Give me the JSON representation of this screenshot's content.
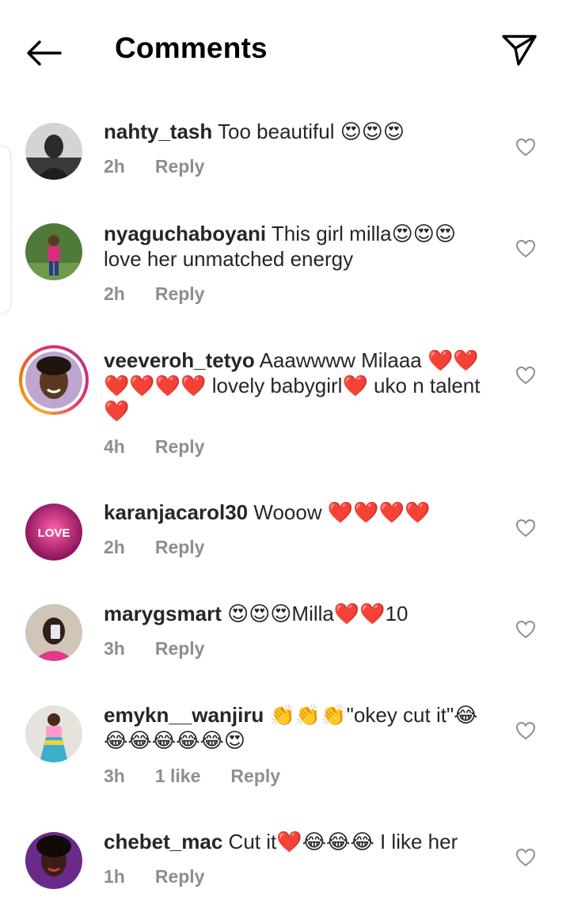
{
  "header": {
    "title": "Comments",
    "back_icon": "arrow-left-icon",
    "share_icon": "paper-plane-icon"
  },
  "comments": [
    {
      "username": "nahty_tash",
      "text": "Too beautiful 😍😍😍",
      "time": "2h",
      "likes": "",
      "reply": "Reply"
    },
    {
      "username": "nyaguchaboyani",
      "text": "This girl milla😍😍😍 love her unmatched energy",
      "time": "2h",
      "likes": "",
      "reply": "Reply"
    },
    {
      "username": "veeveroh_tetyo",
      "text": "Aaawwww Milaaa ❤️❤️❤️❤️❤️❤️ lovely babygirl❤️ uko n talent❤️",
      "time": "4h",
      "likes": "",
      "reply": "Reply"
    },
    {
      "username": "karanjacarol30",
      "text": "Wooow ❤️❤️❤️❤️",
      "time": "2h",
      "likes": "",
      "reply": "Reply"
    },
    {
      "username": "marygsmart",
      "text": "😍😍😍Milla❤️❤️10",
      "time": "3h",
      "likes": "",
      "reply": "Reply"
    },
    {
      "username": "emykn__wanjiru",
      "text": "👏👏👏\"okey cut it\"😂😂😂😂😂😂😍",
      "time": "3h",
      "likes": "1 like",
      "reply": "Reply"
    },
    {
      "username": "chebet_mac",
      "text": "Cut it❤️😂😂😂 I like her",
      "time": "1h",
      "likes": "",
      "reply": "Reply"
    }
  ],
  "avatar_badge_text": "LOVE",
  "colors": {
    "text": "#262626",
    "secondary": "#8e8e8e",
    "story_ring": "#e1306c"
  }
}
